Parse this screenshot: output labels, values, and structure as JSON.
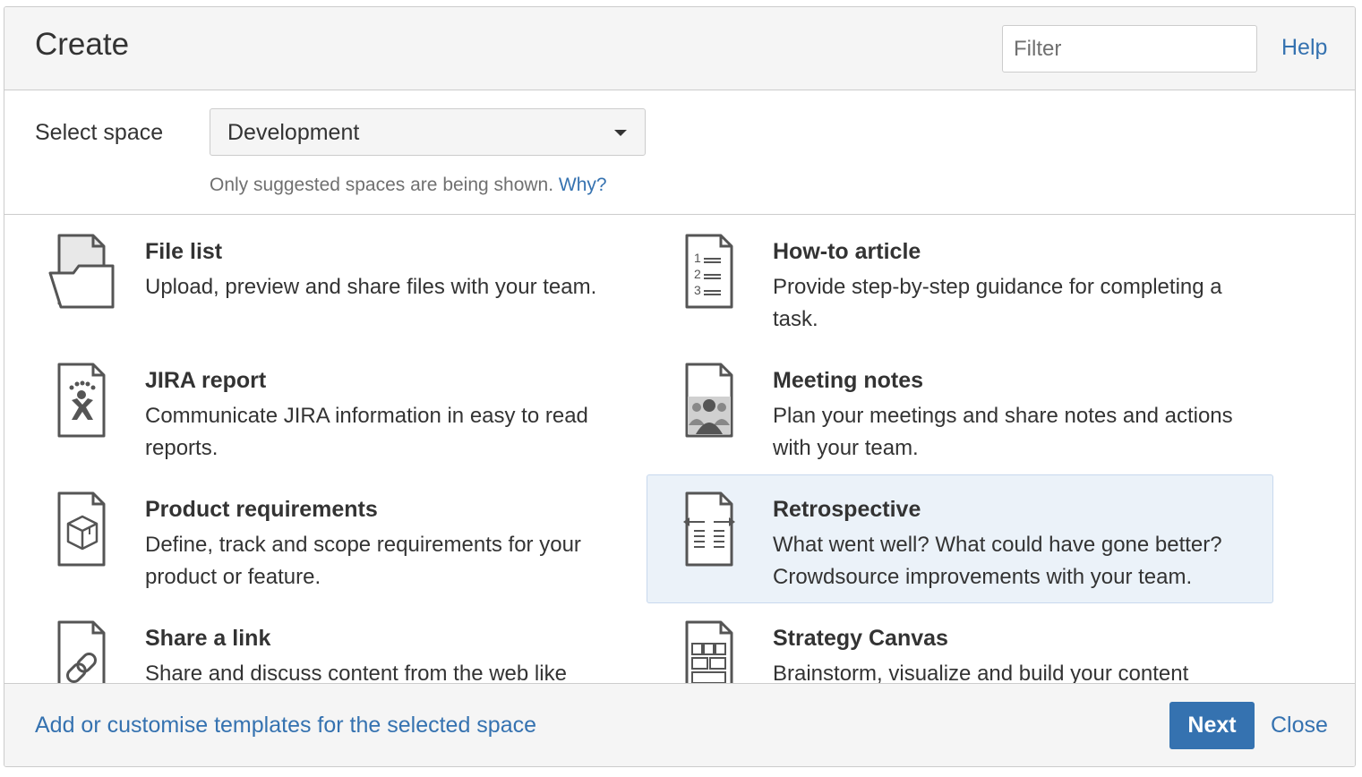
{
  "dialog": {
    "title": "Create",
    "help_label": "Help",
    "filter": {
      "placeholder": "Filter",
      "value": ""
    }
  },
  "space": {
    "label": "Select space",
    "selected": "Development",
    "hint": "Only suggested spaces are being shown.",
    "hint_link": "Why?"
  },
  "templates": [
    {
      "name": "File list",
      "description": "Upload, preview and share files with your team.",
      "icon": "folder-icon"
    },
    {
      "name": "How-to article",
      "description": "Provide step-by-step guidance for completing a task.",
      "icon": "numbered-list-icon"
    },
    {
      "name": "JIRA report",
      "description": "Communicate JIRA information in easy to read reports.",
      "icon": "jira-icon"
    },
    {
      "name": "Meeting notes",
      "description": "Plan your meetings and share notes and actions with your team.",
      "icon": "people-icon"
    },
    {
      "name": "Product requirements",
      "description": "Define, track and scope requirements for your product or feature.",
      "icon": "box-icon"
    },
    {
      "name": "Retrospective",
      "description": "What went well? What could have gone better? Crowdsource improvements with your team.",
      "icon": "retrospective-icon",
      "selected": true
    },
    {
      "name": "Share a link",
      "description": "Share and discuss content from the web like",
      "icon": "link-icon"
    },
    {
      "name": "Strategy Canvas",
      "description": "Brainstorm, visualize and build your content",
      "icon": "canvas-icon"
    }
  ],
  "footer": {
    "customise_label": "Add or customise templates for the selected space",
    "next_label": "Next",
    "close_label": "Close"
  },
  "colors": {
    "link": "#3572b0",
    "primary_button": "#3572b0",
    "selected_bg": "#ebf2f9",
    "panel_bg": "#f5f5f5",
    "border": "#cccccc"
  }
}
